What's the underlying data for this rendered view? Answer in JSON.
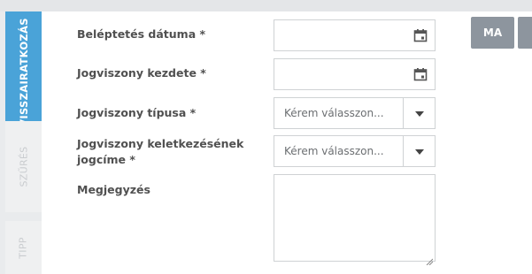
{
  "side_tabs": {
    "active": "VISSZAIRATKOZÁS",
    "filter": "SZŰRÉS",
    "tip": "TIPP"
  },
  "form": {
    "entry_date_label": "Beléptetés dátuma *",
    "start_date_label": "Jogviszony kezdete *",
    "type_label": "Jogviszony típusa *",
    "type_placeholder": "Kérem válasszon...",
    "origin_label_line1": "Jogviszony keletkezésének",
    "origin_label_line2": "jogcíme *",
    "origin_placeholder": "Kérem válasszon...",
    "note_label": "Megjegyzés"
  },
  "buttons": {
    "today": "MA"
  },
  "icons": {
    "calendar": "calendar-icon",
    "dropdown": "chevron-down-icon"
  }
}
